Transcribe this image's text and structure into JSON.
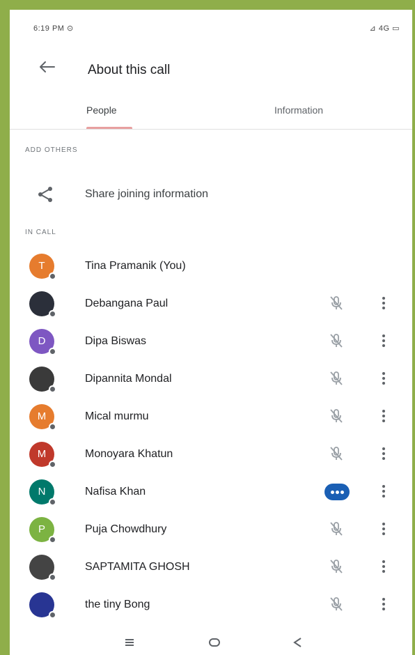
{
  "status": {
    "time": "6:19 PM ⊙",
    "right": "⊿ 4G ▭"
  },
  "appbar": {
    "title": "About this call"
  },
  "tabs": [
    {
      "label": "People"
    },
    {
      "label": "Information"
    }
  ],
  "add_others": {
    "label": "ADD OTHERS",
    "share_label": "Share joining information"
  },
  "people_section": {
    "label": "IN CALL"
  },
  "participants": [
    {
      "name": "Tina Pramanik (You)",
      "initial": "T",
      "color": "#e67c2e",
      "mic": "none"
    },
    {
      "name": "Debangana Paul",
      "initial": "",
      "color": "#2b2f3a",
      "mic": "muted"
    },
    {
      "name": "Dipa Biswas",
      "initial": "D",
      "color": "#7e57c2",
      "mic": "muted"
    },
    {
      "name": "Dipannita Mondal",
      "initial": "",
      "color": "#3a3a3a",
      "mic": "muted"
    },
    {
      "name": "Mical murmu",
      "initial": "M",
      "color": "#e67c2e",
      "mic": "muted"
    },
    {
      "name": "Monoyara Khatun",
      "initial": "M",
      "color": "#c0392b",
      "mic": "muted"
    },
    {
      "name": "Nafisa Khan",
      "initial": "N",
      "color": "#00796b",
      "mic": "speaking"
    },
    {
      "name": "Puja Chowdhury",
      "initial": "P",
      "color": "#7cb342",
      "mic": "muted"
    },
    {
      "name": "SAPTAMITA GHOSH",
      "initial": "",
      "color": "#444444",
      "mic": "muted"
    },
    {
      "name": "the tiny Bong",
      "initial": "",
      "color": "#283593",
      "mic": "muted"
    }
  ],
  "colors": {
    "accent_indicator": "#e8a0a0",
    "speaking": "#1a5fb4",
    "frame": "#8fae4a"
  }
}
